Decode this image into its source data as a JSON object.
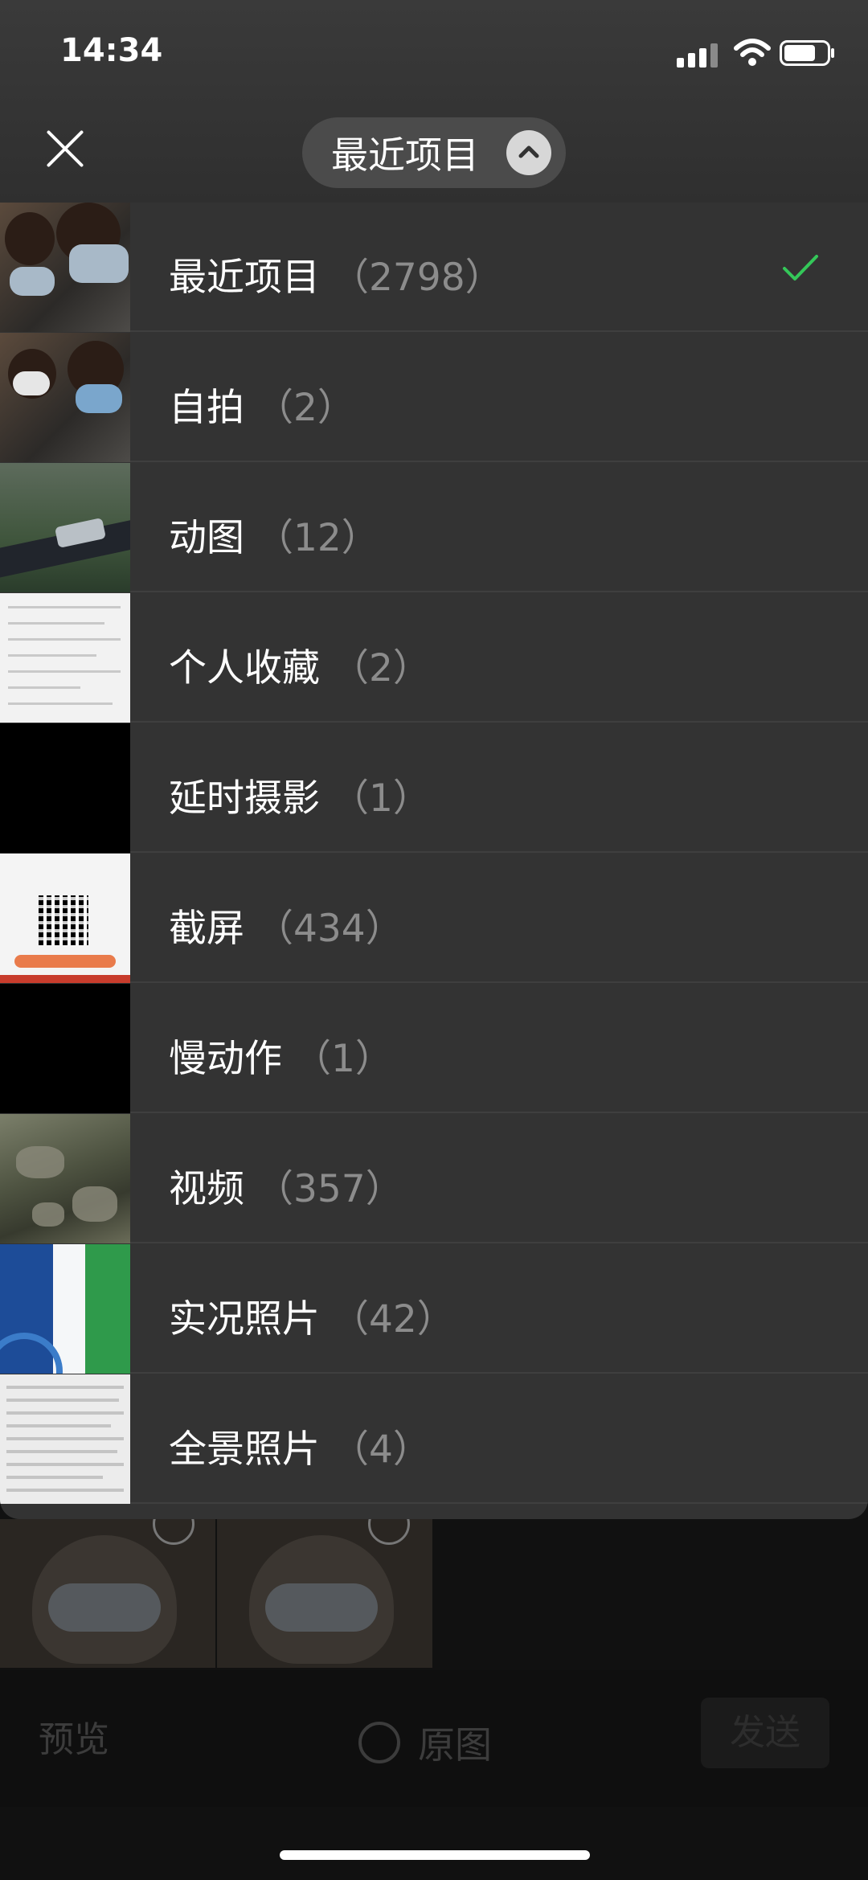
{
  "status_bar": {
    "time": "14:34"
  },
  "header": {
    "album_title": "最近项目"
  },
  "albums": [
    {
      "name": "最近项目",
      "count": "（2798）",
      "selected": true
    },
    {
      "name": "自拍",
      "count": "（2）",
      "selected": false
    },
    {
      "name": "动图",
      "count": "（12）",
      "selected": false
    },
    {
      "name": "个人收藏",
      "count": "（2）",
      "selected": false
    },
    {
      "name": "延时摄影",
      "count": "（1）",
      "selected": false
    },
    {
      "name": "截屏",
      "count": "（434）",
      "selected": false
    },
    {
      "name": "慢动作",
      "count": "（1）",
      "selected": false
    },
    {
      "name": "视频",
      "count": "（357）",
      "selected": false
    },
    {
      "name": "实况照片",
      "count": "（42）",
      "selected": false
    },
    {
      "name": "全景照片",
      "count": "（4）",
      "selected": false
    }
  ],
  "bottom_bar": {
    "preview_label": "预览",
    "original_label": "原图",
    "send_label": "发送"
  },
  "colors": {
    "accent_check": "#34c759",
    "list_bg": "#333333",
    "count_text": "#8c8c8c"
  },
  "icons": [
    "close-icon",
    "chevron-up-icon",
    "checkmark-icon",
    "signal-icon",
    "wifi-icon",
    "battery-icon"
  ]
}
